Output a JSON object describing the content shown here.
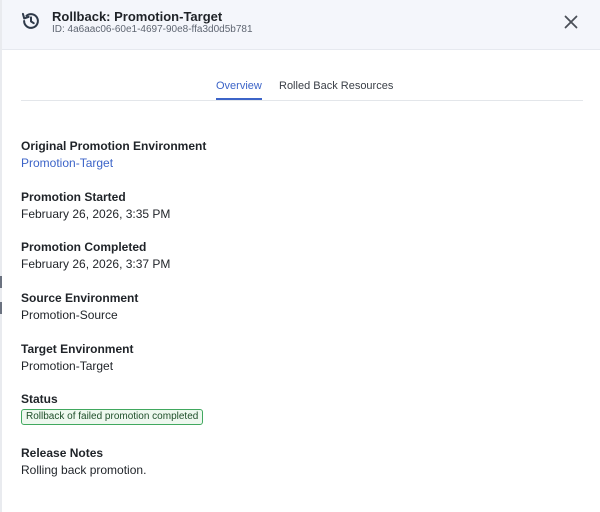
{
  "header": {
    "title": "Rollback: Promotion-Target",
    "id_text": "ID: 4a6aac06-60e1-4697-90e8-ffa3d0d5b781"
  },
  "tabs": [
    {
      "label": "Overview",
      "active": true
    },
    {
      "label": "Rolled Back Resources",
      "active": false
    }
  ],
  "details": {
    "original_env_label": "Original Promotion Environment",
    "original_env_value": "Promotion-Target",
    "started_label": "Promotion Started",
    "started_value": "February 26, 2026, 3:35 PM",
    "completed_label": "Promotion Completed",
    "completed_value": "February 26, 2026, 3:37 PM",
    "source_label": "Source Environment",
    "source_value": "Promotion-Source",
    "target_label": "Target Environment",
    "target_value": "Promotion-Target",
    "status_label": "Status",
    "status_value": "Rollback of failed promotion completed",
    "notes_label": "Release Notes",
    "notes_value": "Rolling back promotion."
  },
  "icons": {
    "header_icon": "history-icon",
    "close_icon": "close-icon"
  },
  "colors": {
    "accent": "#3c64c8",
    "status_border": "#41a85f",
    "status_bg": "#eef8ef",
    "header_bg": "#f4f6fb"
  }
}
